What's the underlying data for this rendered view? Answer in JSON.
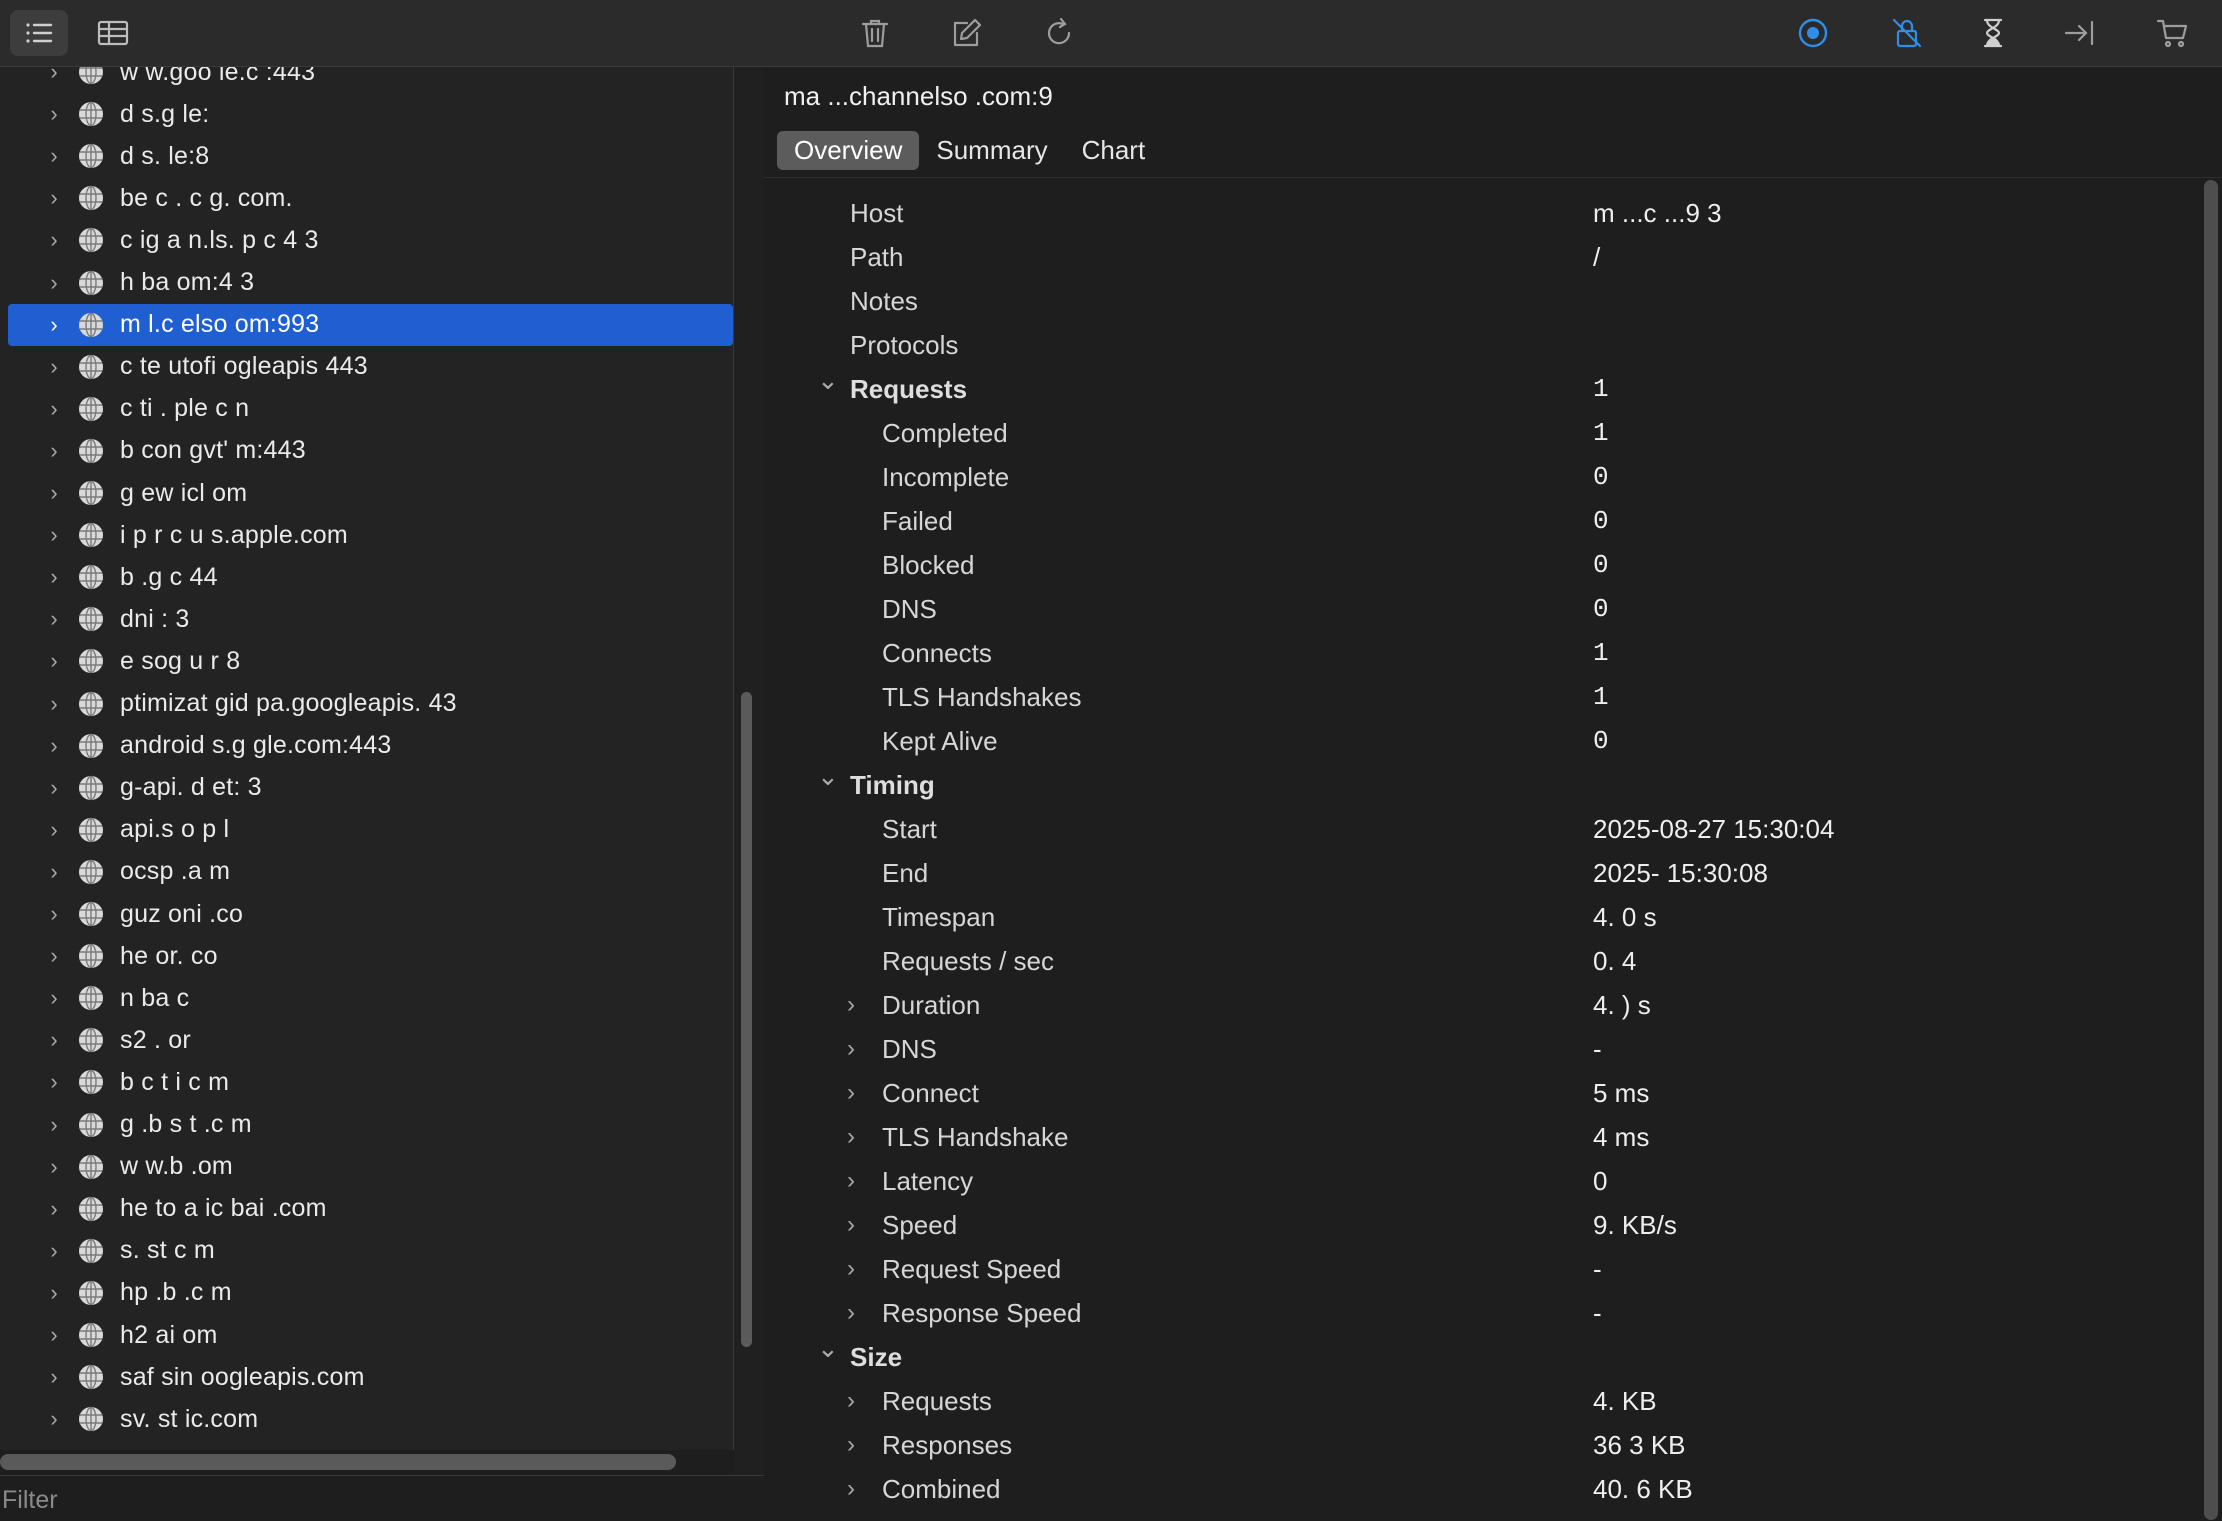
{
  "toolbar": {
    "left_icons": [
      "list-icon",
      "table-icon"
    ],
    "center_icons": [
      "trash-icon",
      "edit-icon",
      "refresh-icon"
    ],
    "right_icons": [
      "record-icon",
      "ssl-proxy-icon",
      "throttle-icon",
      "step-icon",
      "cart-icon"
    ],
    "accent_color": "#2f8ee8"
  },
  "sidebar": {
    "hosts": [
      {
        "name": "w w.goo le.c :443"
      },
      {
        "name": "d s.g le:"
      },
      {
        "name": "d s. le:8"
      },
      {
        "name": "be c . c g. com."
      },
      {
        "name": "c ig a n.ls. p c 4 3"
      },
      {
        "name": "h ba om:4 3"
      },
      {
        "name": "m l.c elso om:993",
        "selected": true
      },
      {
        "name": "c te utofi ogleapis 443"
      },
      {
        "name": "c ti . ple c n"
      },
      {
        "name": "b con gvt' m:443"
      },
      {
        "name": "g ew icl om"
      },
      {
        "name": "i p r c u s.apple.com"
      },
      {
        "name": "b .g c 44"
      },
      {
        "name": "dni : 3"
      },
      {
        "name": "e sog u r 8"
      },
      {
        "name": "ptimizat gid pa.googleapis. 43"
      },
      {
        "name": "android s.g gle.com:443"
      },
      {
        "name": "g-api. d et: 3"
      },
      {
        "name": "api.s o p l"
      },
      {
        "name": "ocsp .a m"
      },
      {
        "name": "guz oni .co"
      },
      {
        "name": "he or. co"
      },
      {
        "name": "n ba c"
      },
      {
        "name": "s2 . or"
      },
      {
        "name": "b c t i c m"
      },
      {
        "name": "g .b s t .c m"
      },
      {
        "name": "w w.b .om"
      },
      {
        "name": "he to a ic bai .com"
      },
      {
        "name": "s. st c m"
      },
      {
        "name": "hp .b .c m"
      },
      {
        "name": "h2 ai om"
      },
      {
        "name": "saf sin oogleapis.com"
      },
      {
        "name": "sv. st ic.com"
      }
    ]
  },
  "filter": {
    "placeholder": "Filter"
  },
  "detail": {
    "title": "ma ...channelso .com:9",
    "tabs": [
      {
        "label": "Overview",
        "active": true
      },
      {
        "label": "Summary"
      },
      {
        "label": "Chart"
      }
    ],
    "rows": [
      {
        "label": "Host",
        "value": "m ...c ...9 3",
        "level": 0
      },
      {
        "label": "Path",
        "value": "/",
        "level": 0
      },
      {
        "label": "Notes",
        "value": "",
        "level": 0
      },
      {
        "label": "Protocols",
        "value": "",
        "level": 0
      },
      {
        "label": "Requests",
        "value": "1",
        "level": 0,
        "section": true,
        "expanded": true,
        "mono": true
      },
      {
        "label": "Completed",
        "value": "1",
        "level": 1,
        "mono": true
      },
      {
        "label": "Incomplete",
        "value": "0",
        "level": 1,
        "mono": true
      },
      {
        "label": "Failed",
        "value": "0",
        "level": 1,
        "mono": true
      },
      {
        "label": "Blocked",
        "value": "0",
        "level": 1,
        "mono": true
      },
      {
        "label": "DNS",
        "value": "0",
        "level": 1,
        "mono": true
      },
      {
        "label": "Connects",
        "value": "1",
        "level": 1,
        "mono": true
      },
      {
        "label": "TLS Handshakes",
        "value": "1",
        "level": 1,
        "mono": true
      },
      {
        "label": "Kept Alive",
        "value": "0",
        "level": 1,
        "mono": true
      },
      {
        "label": "Timing",
        "value": "",
        "level": 0,
        "section": true,
        "expanded": true
      },
      {
        "label": "Start",
        "value": "2025-08-27 15:30:04",
        "level": 1
      },
      {
        "label": "End",
        "value": "2025- 15:30:08",
        "level": 1
      },
      {
        "label": "Timespan",
        "value": "4. 0 s",
        "level": 1
      },
      {
        "label": "Requests / sec",
        "value": "0. 4",
        "level": 1
      },
      {
        "label": "Duration",
        "value": "4. ) s",
        "level": 1,
        "collapsible": true
      },
      {
        "label": "DNS",
        "value": "-",
        "level": 1,
        "collapsible": true
      },
      {
        "label": "Connect",
        "value": "5 ms",
        "level": 1,
        "collapsible": true
      },
      {
        "label": "TLS Handshake",
        "value": "4 ms",
        "level": 1,
        "collapsible": true
      },
      {
        "label": "Latency",
        "value": "0",
        "level": 1,
        "collapsible": true
      },
      {
        "label": "Speed",
        "value": "9. KB/s",
        "level": 1,
        "collapsible": true
      },
      {
        "label": "Request Speed",
        "value": "-",
        "level": 1,
        "collapsible": true
      },
      {
        "label": "Response Speed",
        "value": "-",
        "level": 1,
        "collapsible": true
      },
      {
        "label": "Size",
        "value": "",
        "level": 0,
        "section": true,
        "expanded": true
      },
      {
        "label": "Requests",
        "value": "4. KB",
        "level": 1,
        "collapsible": true
      },
      {
        "label": "Responses",
        "value": "36 3 KB",
        "level": 1,
        "collapsible": true
      },
      {
        "label": "Combined",
        "value": "40. 6 KB",
        "level": 1,
        "collapsible": true
      }
    ]
  }
}
